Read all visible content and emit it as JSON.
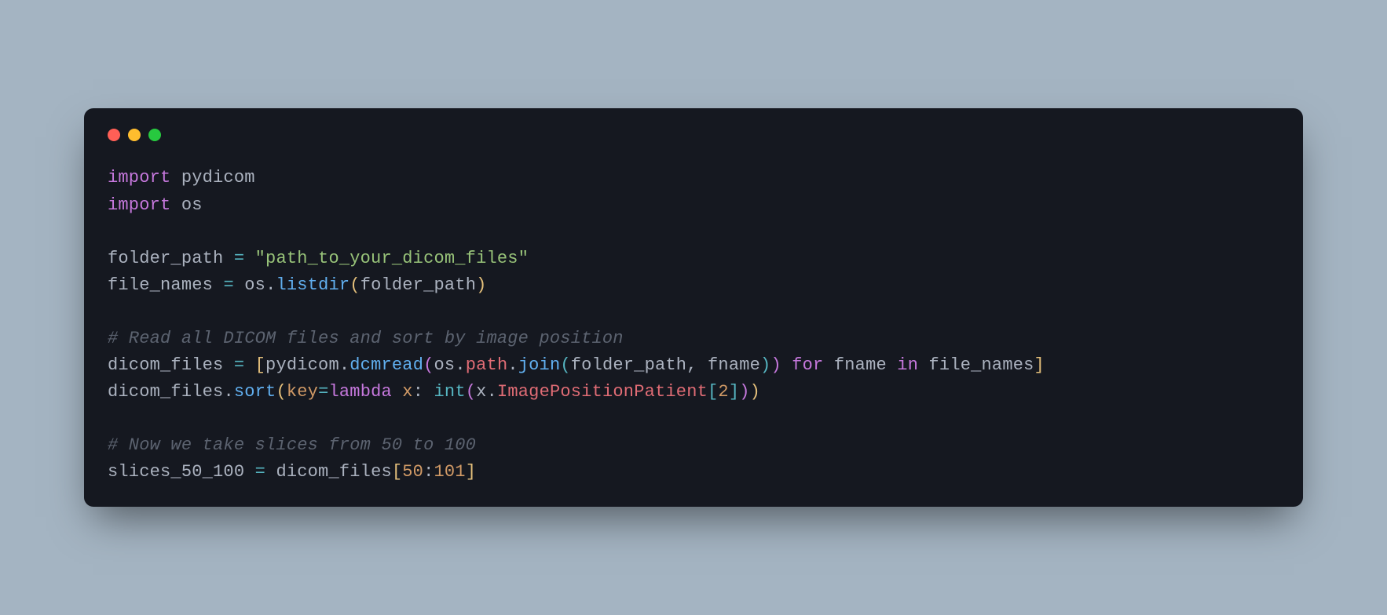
{
  "traffic_lights": {
    "red": "#ff5f56",
    "yellow": "#ffbd2e",
    "green": "#27c93f"
  },
  "code": {
    "line1_import": "import",
    "line1_module": "pydicom",
    "line2_import": "import",
    "line2_module": "os",
    "line4_var": "folder_path ",
    "line4_eq": "=",
    "line4_str": " \"path_to_your_dicom_files\"",
    "line5_var": "file_names ",
    "line5_eq": "=",
    "line5_sp1": " os",
    "line5_dot1": ".",
    "line5_func": "listdir",
    "line5_lp": "(",
    "line5_arg": "folder_path",
    "line5_rp": ")",
    "line7_comment": "# Read all DICOM files and sort by image position",
    "line8_var": "dicom_files ",
    "line8_eq": "=",
    "line8_sp": " ",
    "line8_lb": "[",
    "line8_mod": "pydicom",
    "line8_dot1": ".",
    "line8_func1": "dcmread",
    "line8_lp1": "(",
    "line8_os": "os",
    "line8_dot2": ".",
    "line8_path": "path",
    "line8_dot3": ".",
    "line8_join": "join",
    "line8_lp2": "(",
    "line8_arg1": "folder_path",
    "line8_comma": ", ",
    "line8_arg2": "fname",
    "line8_rp2": ")",
    "line8_rp1": ")",
    "line8_sp2": " ",
    "line8_for": "for",
    "line8_sp3": " fname ",
    "line8_in": "in",
    "line8_sp4": " file_names",
    "line8_rb": "]",
    "line9_var": "dicom_files",
    "line9_dot": ".",
    "line9_sort": "sort",
    "line9_lp": "(",
    "line9_key": "key",
    "line9_eq": "=",
    "line9_lambda": "lambda",
    "line9_x": " x",
    "line9_colon": ": ",
    "line9_int": "int",
    "line9_lp2": "(",
    "line9_x2": "x",
    "line9_dot2": ".",
    "line9_attr": "ImagePositionPatient",
    "line9_lb": "[",
    "line9_num": "2",
    "line9_rb": "]",
    "line9_rp2": ")",
    "line9_rp": ")",
    "line11_comment": "# Now we take slices from 50 to 100",
    "line12_var": "slices_50_100 ",
    "line12_eq": "=",
    "line12_sp": " dicom_files",
    "line12_lb": "[",
    "line12_n1": "50",
    "line12_colon": ":",
    "line12_n2": "101",
    "line12_rb": "]"
  }
}
